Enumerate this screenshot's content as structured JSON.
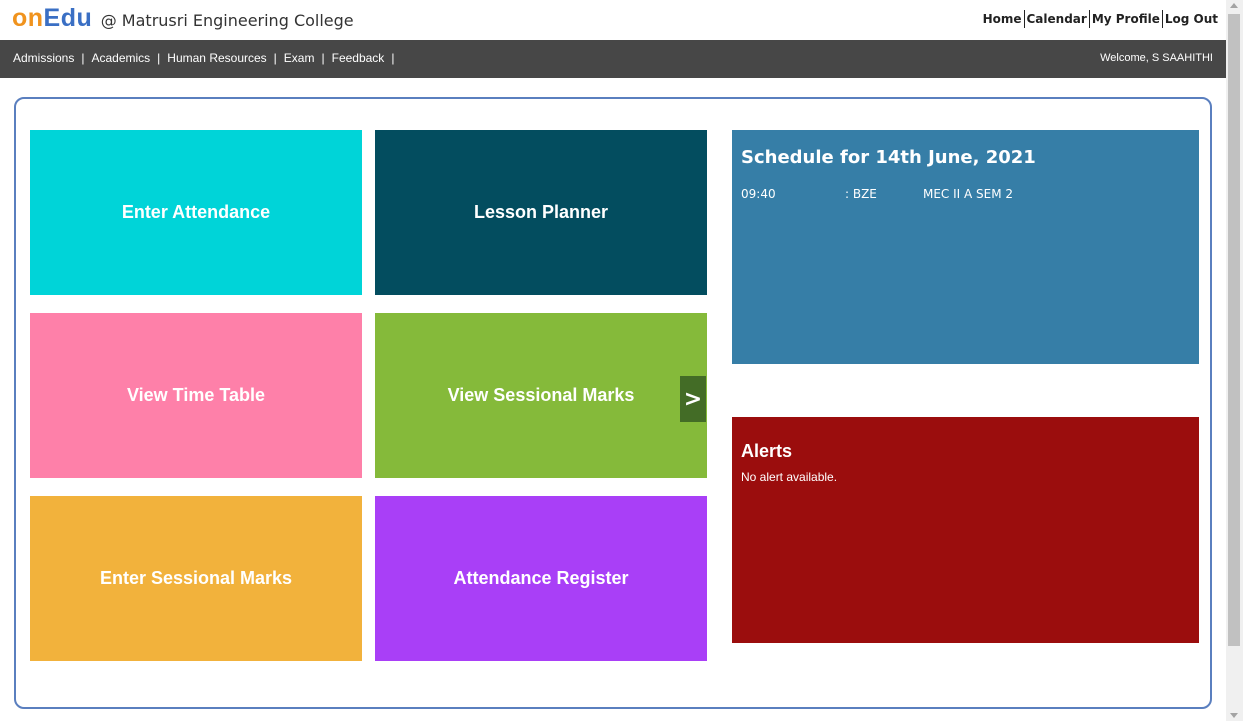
{
  "header": {
    "logo_on": "on",
    "logo_edu": "Edu",
    "college": "@ Matrusri Engineering College",
    "links": [
      "Home",
      "Calendar",
      "My Profile",
      "Log Out"
    ]
  },
  "nav": {
    "menu": [
      "Admissions",
      "Academics",
      "Human Resources",
      "Exam",
      "Feedback"
    ],
    "separator": "|",
    "welcome": "Welcome, S SAAHITHI"
  },
  "tiles": [
    {
      "label": "Enter Attendance",
      "color": "#00d4d8"
    },
    {
      "label": "Lesson Planner",
      "color": "#034d5f"
    },
    {
      "label": "View Time Table",
      "color": "#fe80a9"
    },
    {
      "label": "View Sessional Marks",
      "color": "#85ba3a"
    },
    {
      "label": "Enter Sessional Marks",
      "color": "#f2b23c"
    },
    {
      "label": "Attendance Register",
      "color": "#a93ff7"
    }
  ],
  "next_arrow": ">",
  "schedule": {
    "title": "Schedule for 14th June, 2021",
    "rows": [
      {
        "time": "09:40",
        "subject": ": BZE",
        "class": "MEC II A SEM 2"
      }
    ]
  },
  "alerts": {
    "title": "Alerts",
    "message": "No alert available."
  }
}
